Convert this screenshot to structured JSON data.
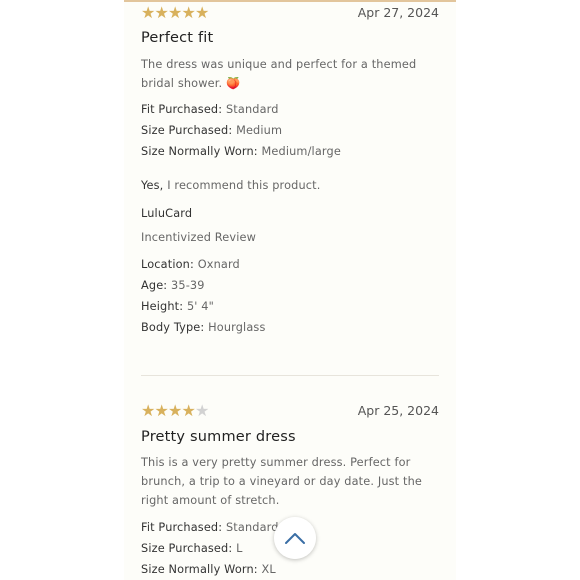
{
  "reviews": [
    {
      "rating": 5,
      "max_rating": 5,
      "date": "Apr 27, 2024",
      "title": "Perfect fit",
      "body": "The dress was unique and perfect for a themed bridal shower. 🍑",
      "fit_label": "Fit Purchased:",
      "fit_value": "Standard",
      "size_label": "Size Purchased:",
      "size_value": "Medium",
      "normal_label": "Size Normally Worn:",
      "normal_value": "Medium/large",
      "recommend_yes": "Yes,",
      "recommend_text": "I recommend this product.",
      "membership": "LuluCard",
      "incentivized": "Incentivized Review",
      "location_label": "Location:",
      "location_value": "Oxnard",
      "age_label": "Age:",
      "age_value": "35-39",
      "height_label": "Height:",
      "height_value": "5' 4\"",
      "body_label": "Body Type:",
      "body_value": "Hourglass"
    },
    {
      "rating": 4,
      "max_rating": 5,
      "date": "Apr 25, 2024",
      "title": "Pretty summer dress",
      "body": "This is a very pretty summer dress. Perfect for brunch, a trip to a vineyard or day date. Just the right amount of stretch.",
      "fit_label": "Fit Purchased:",
      "fit_value": "Standard",
      "size_label": "Size Purchased:",
      "size_value": "L",
      "normal_label": "Size Normally Worn:",
      "normal_value": "XL"
    }
  ],
  "colors": {
    "star_filled": "#d8b15d",
    "star_empty": "#d2d2d2",
    "accent_rule": "#e2c59c",
    "chevron": "#3a6ea5"
  },
  "icons": {
    "back_to_top": "chevron-up-icon",
    "star": "star-icon"
  }
}
